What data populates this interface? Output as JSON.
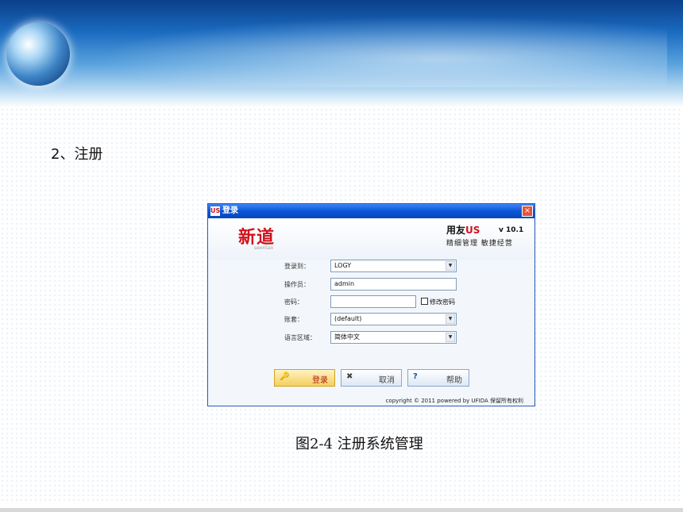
{
  "slide": {
    "heading": "2、注册",
    "caption": "图2-4 注册系统管理"
  },
  "window": {
    "title": "登录",
    "icon_text": "US",
    "close_glyph": "×"
  },
  "branding": {
    "left_logo": "新道",
    "left_logo_sub": "seentao",
    "right_logo_prefix": "用友",
    "right_logo_mark": "US",
    "version": "v 10.1",
    "slogan": "精细管理 敏捷经营"
  },
  "form": {
    "login_to": {
      "label": "登录到：",
      "value": "LOGY"
    },
    "operator": {
      "label": "操作员：",
      "value": "admin"
    },
    "password": {
      "label": "密码：",
      "value": "",
      "change_password_label": "修改密码"
    },
    "account_set": {
      "label": "账套：",
      "value": "(default)"
    },
    "language": {
      "label": "语言区域：",
      "value": "简体中文"
    }
  },
  "buttons": {
    "login": {
      "icon": "🔑",
      "label": "登录"
    },
    "cancel": {
      "icon": "✖",
      "label": "取消"
    },
    "help": {
      "icon": "?",
      "label": "帮助"
    }
  },
  "footer": {
    "copyright": "copyright © 2011 powered by UFIDA 保留所有权利"
  }
}
